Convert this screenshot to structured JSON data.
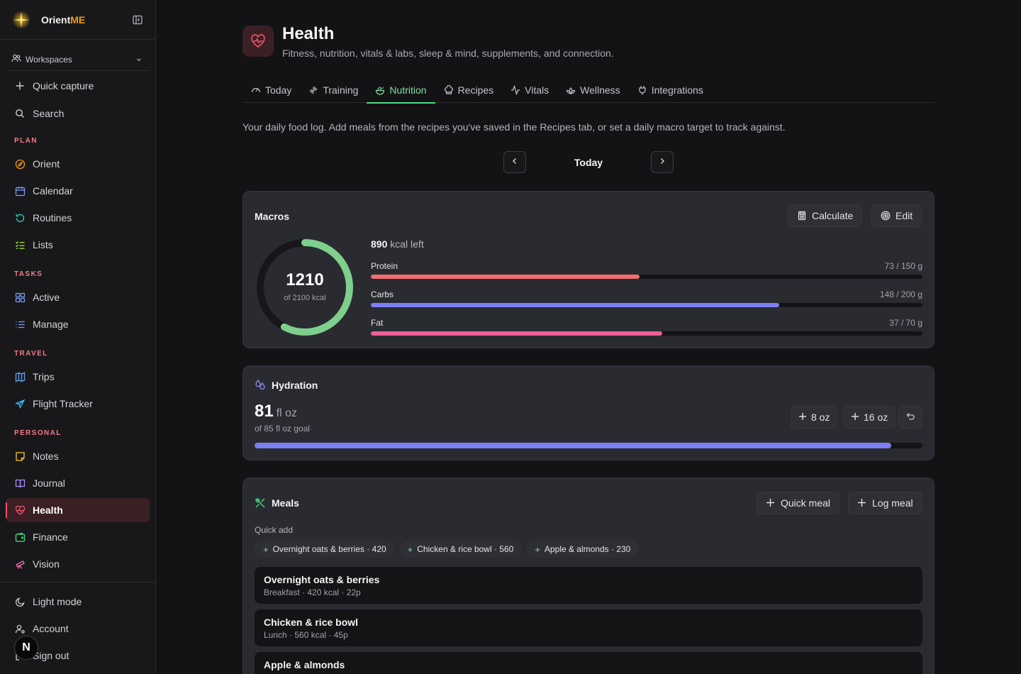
{
  "brand": {
    "name_prefix": "Orient",
    "name_suffix": "ME"
  },
  "workspace": {
    "label": "Workspaces"
  },
  "top_actions": [
    {
      "label": "Quick capture",
      "icon": "plus-icon"
    },
    {
      "label": "Search",
      "icon": "search-icon"
    }
  ],
  "sections": {
    "plan": "PLAN",
    "tasks": "TASKS",
    "travel": "TRAVEL",
    "personal": "PERSONAL"
  },
  "nav": {
    "orient": "Orient",
    "calendar": "Calendar",
    "routines": "Routines",
    "lists": "Lists",
    "active": "Active",
    "manage": "Manage",
    "trips": "Trips",
    "flight_tracker": "Flight Tracker",
    "notes": "Notes",
    "journal": "Journal",
    "health": "Health",
    "finance": "Finance",
    "vision": "Vision"
  },
  "footer": {
    "light_mode": "Light mode",
    "account": "Account",
    "sign_out": "Sign out",
    "avatar_letter": "N"
  },
  "page": {
    "title": "Health",
    "subtitle": "Fitness, nutrition, vitals & labs, sleep & mind, supplements, and connection."
  },
  "tabs": [
    {
      "label": "Today",
      "active": false
    },
    {
      "label": "Training",
      "active": false
    },
    {
      "label": "Nutrition",
      "active": true
    },
    {
      "label": "Recipes",
      "active": false
    },
    {
      "label": "Vitals",
      "active": false
    },
    {
      "label": "Wellness",
      "active": false
    },
    {
      "label": "Integrations",
      "active": false
    }
  ],
  "intro": "Your daily food log. Add meals from the recipes you've saved in the Recipes tab, or set a daily macro target to track against.",
  "date_nav": {
    "label": "Today"
  },
  "macros": {
    "title": "Macros",
    "calculate_label": "Calculate",
    "edit_label": "Edit",
    "calories": 1210,
    "calories_goal": 2100,
    "calories_sub": "of 2100 kcal",
    "kcal_left_value": "890",
    "kcal_left_unit": " kcal left",
    "items": [
      {
        "name": "Protein",
        "value_text": "73 / 150 g",
        "current": 73,
        "goal": 150,
        "color": "#f26d6d"
      },
      {
        "name": "Carbs",
        "value_text": "148 / 200 g",
        "current": 148,
        "goal": 200,
        "color": "#7c7ff0"
      },
      {
        "name": "Fat",
        "value_text": "37 / 70 g",
        "current": 37,
        "goal": 70,
        "color": "#ef5f9a"
      }
    ],
    "ring_color": "#7ecf8c"
  },
  "hydration": {
    "title": "Hydration",
    "amount": "81",
    "unit": "fl oz",
    "goal_text": "of 85 fl oz goal",
    "current": 81,
    "goal": 85,
    "add_8_label": "8 oz",
    "add_16_label": "16 oz"
  },
  "meals": {
    "title": "Meals",
    "quick_meal_label": "Quick meal",
    "log_meal_label": "Log meal",
    "quick_add_label": "Quick add",
    "quick_add": [
      "Overnight oats & berries · 420",
      "Chicken & rice bowl · 560",
      "Apple & almonds · 230"
    ],
    "entries": [
      {
        "name": "Overnight oats & berries",
        "meta": "Breakfast · 420 kcal · 22p"
      },
      {
        "name": "Chicken & rice bowl",
        "meta": "Lunch · 560 kcal · 45p"
      },
      {
        "name": "Apple & almonds",
        "meta": ""
      }
    ]
  }
}
